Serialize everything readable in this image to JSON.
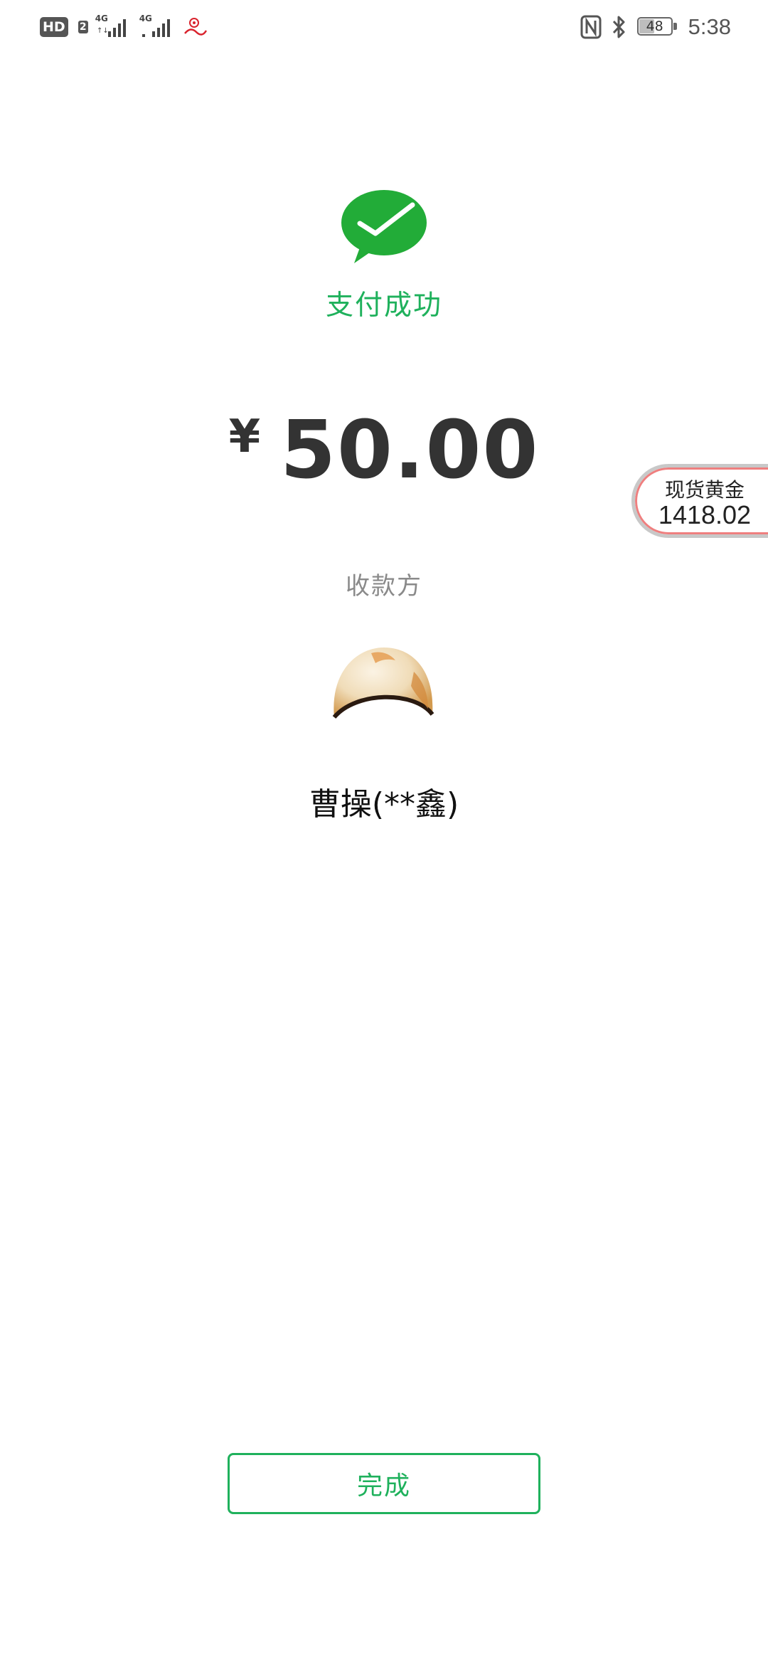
{
  "status_bar": {
    "hd_label": "HD",
    "hd_sub": "2",
    "signal1_label": "4G",
    "signal2_label": "4G",
    "battery_percent": "48",
    "battery_level": 0.48,
    "time": "5:38",
    "icons": [
      "hd-icon",
      "signal-icon",
      "signal-icon",
      "sina-icon",
      "nfc-icon",
      "bluetooth-icon",
      "battery-icon"
    ]
  },
  "payment": {
    "status_text": "支付成功",
    "currency_symbol": "¥",
    "amount": "50.00",
    "payee_label": "收款方",
    "payee_name": "曹操(**鑫)",
    "accent_color": "#1fb15c"
  },
  "gold_widget": {
    "title": "现货黄金",
    "price": "1418.02"
  },
  "actions": {
    "done_label": "完成"
  }
}
